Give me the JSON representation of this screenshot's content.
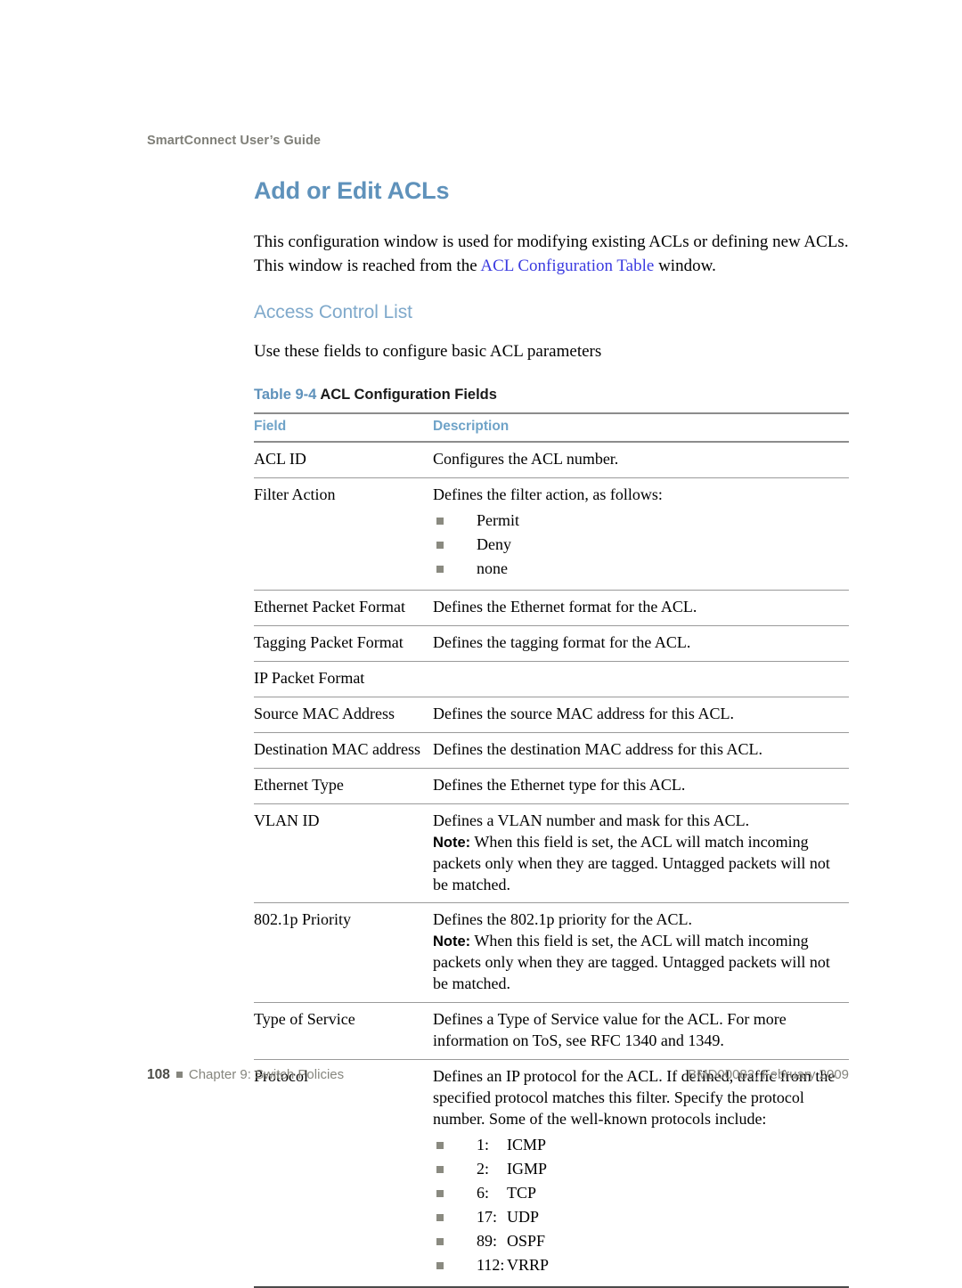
{
  "running_header": "SmartConnect User’s Guide",
  "page_title": "Add or Edit ACLs",
  "intro": {
    "before_link": "This configuration window is used for modifying existing ACLs or defining new ACLs. This window is reached from the ",
    "link_text": "ACL Configuration Table",
    "after_link": " window."
  },
  "section": {
    "title": "Access Control List",
    "lead": "Use these fields to configure basic ACL parameters"
  },
  "table": {
    "caption_number": "Table 9-4",
    "caption_label": "ACL Configuration Fields",
    "columns": [
      "Field",
      "Description"
    ],
    "rows": [
      {
        "field": "ACL ID",
        "desc": "Configures the ACL number."
      },
      {
        "field": "Filter Action",
        "desc": "Defines the filter action, as follows:",
        "bullets": [
          "Permit",
          "Deny",
          "none"
        ]
      },
      {
        "field": "Ethernet Packet Format",
        "desc": "Defines the Ethernet format for the ACL."
      },
      {
        "field": "Tagging Packet Format",
        "desc": "Defines the tagging format for the ACL."
      },
      {
        "field": "IP Packet Format",
        "desc": ""
      },
      {
        "field": "Source MAC Address",
        "desc": "Defines the source MAC address for this ACL."
      },
      {
        "field": "Destination MAC address",
        "desc": "Defines the destination MAC address for this ACL."
      },
      {
        "field": "Ethernet Type",
        "desc": "Defines the Ethernet type for this ACL."
      },
      {
        "field": "VLAN ID",
        "desc": "Defines a VLAN number and mask for this ACL.",
        "note_label": "Note:",
        "note_text": " When this field is set, the ACL will match incoming packets only when they are tagged. Untagged packets will not be matched."
      },
      {
        "field": "802.1p Priority",
        "desc": "Defines the 802.1p priority for the ACL.",
        "note_label": "Note:",
        "note_text": " When this field is set, the ACL will match incoming packets only when they are tagged. Untagged packets will not be matched."
      },
      {
        "field": "Type of Service",
        "desc": "Defines a Type of Service value for the ACL. For more information on ToS, see RFC 1340 and 1349."
      },
      {
        "field": "Protocol",
        "desc": "Defines an IP protocol for the ACL. If defined, traffic from the specified protocol matches this filter. Specify the protocol number. Some of the well-known protocols include:",
        "protocols": [
          {
            "num": "1:",
            "name": "ICMP"
          },
          {
            "num": "2:",
            "name": "IGMP"
          },
          {
            "num": "6:",
            "name": "TCP"
          },
          {
            "num": "17:",
            "name": "UDP"
          },
          {
            "num": "89:",
            "name": "OSPF"
          },
          {
            "num": "112:",
            "name": "VRRP"
          }
        ]
      }
    ]
  },
  "footer": {
    "page_number": "108",
    "chapter": "Chapter 9: Switch Policies",
    "doc_id": "BMD00082, February 2009"
  },
  "colors": {
    "title_blue": "#5f92bb",
    "section_blue": "#7fa9cb",
    "header_gray": "#7f7f78",
    "link_blue": "#3a3ae0",
    "bullet_gray": "#8a8a80"
  }
}
